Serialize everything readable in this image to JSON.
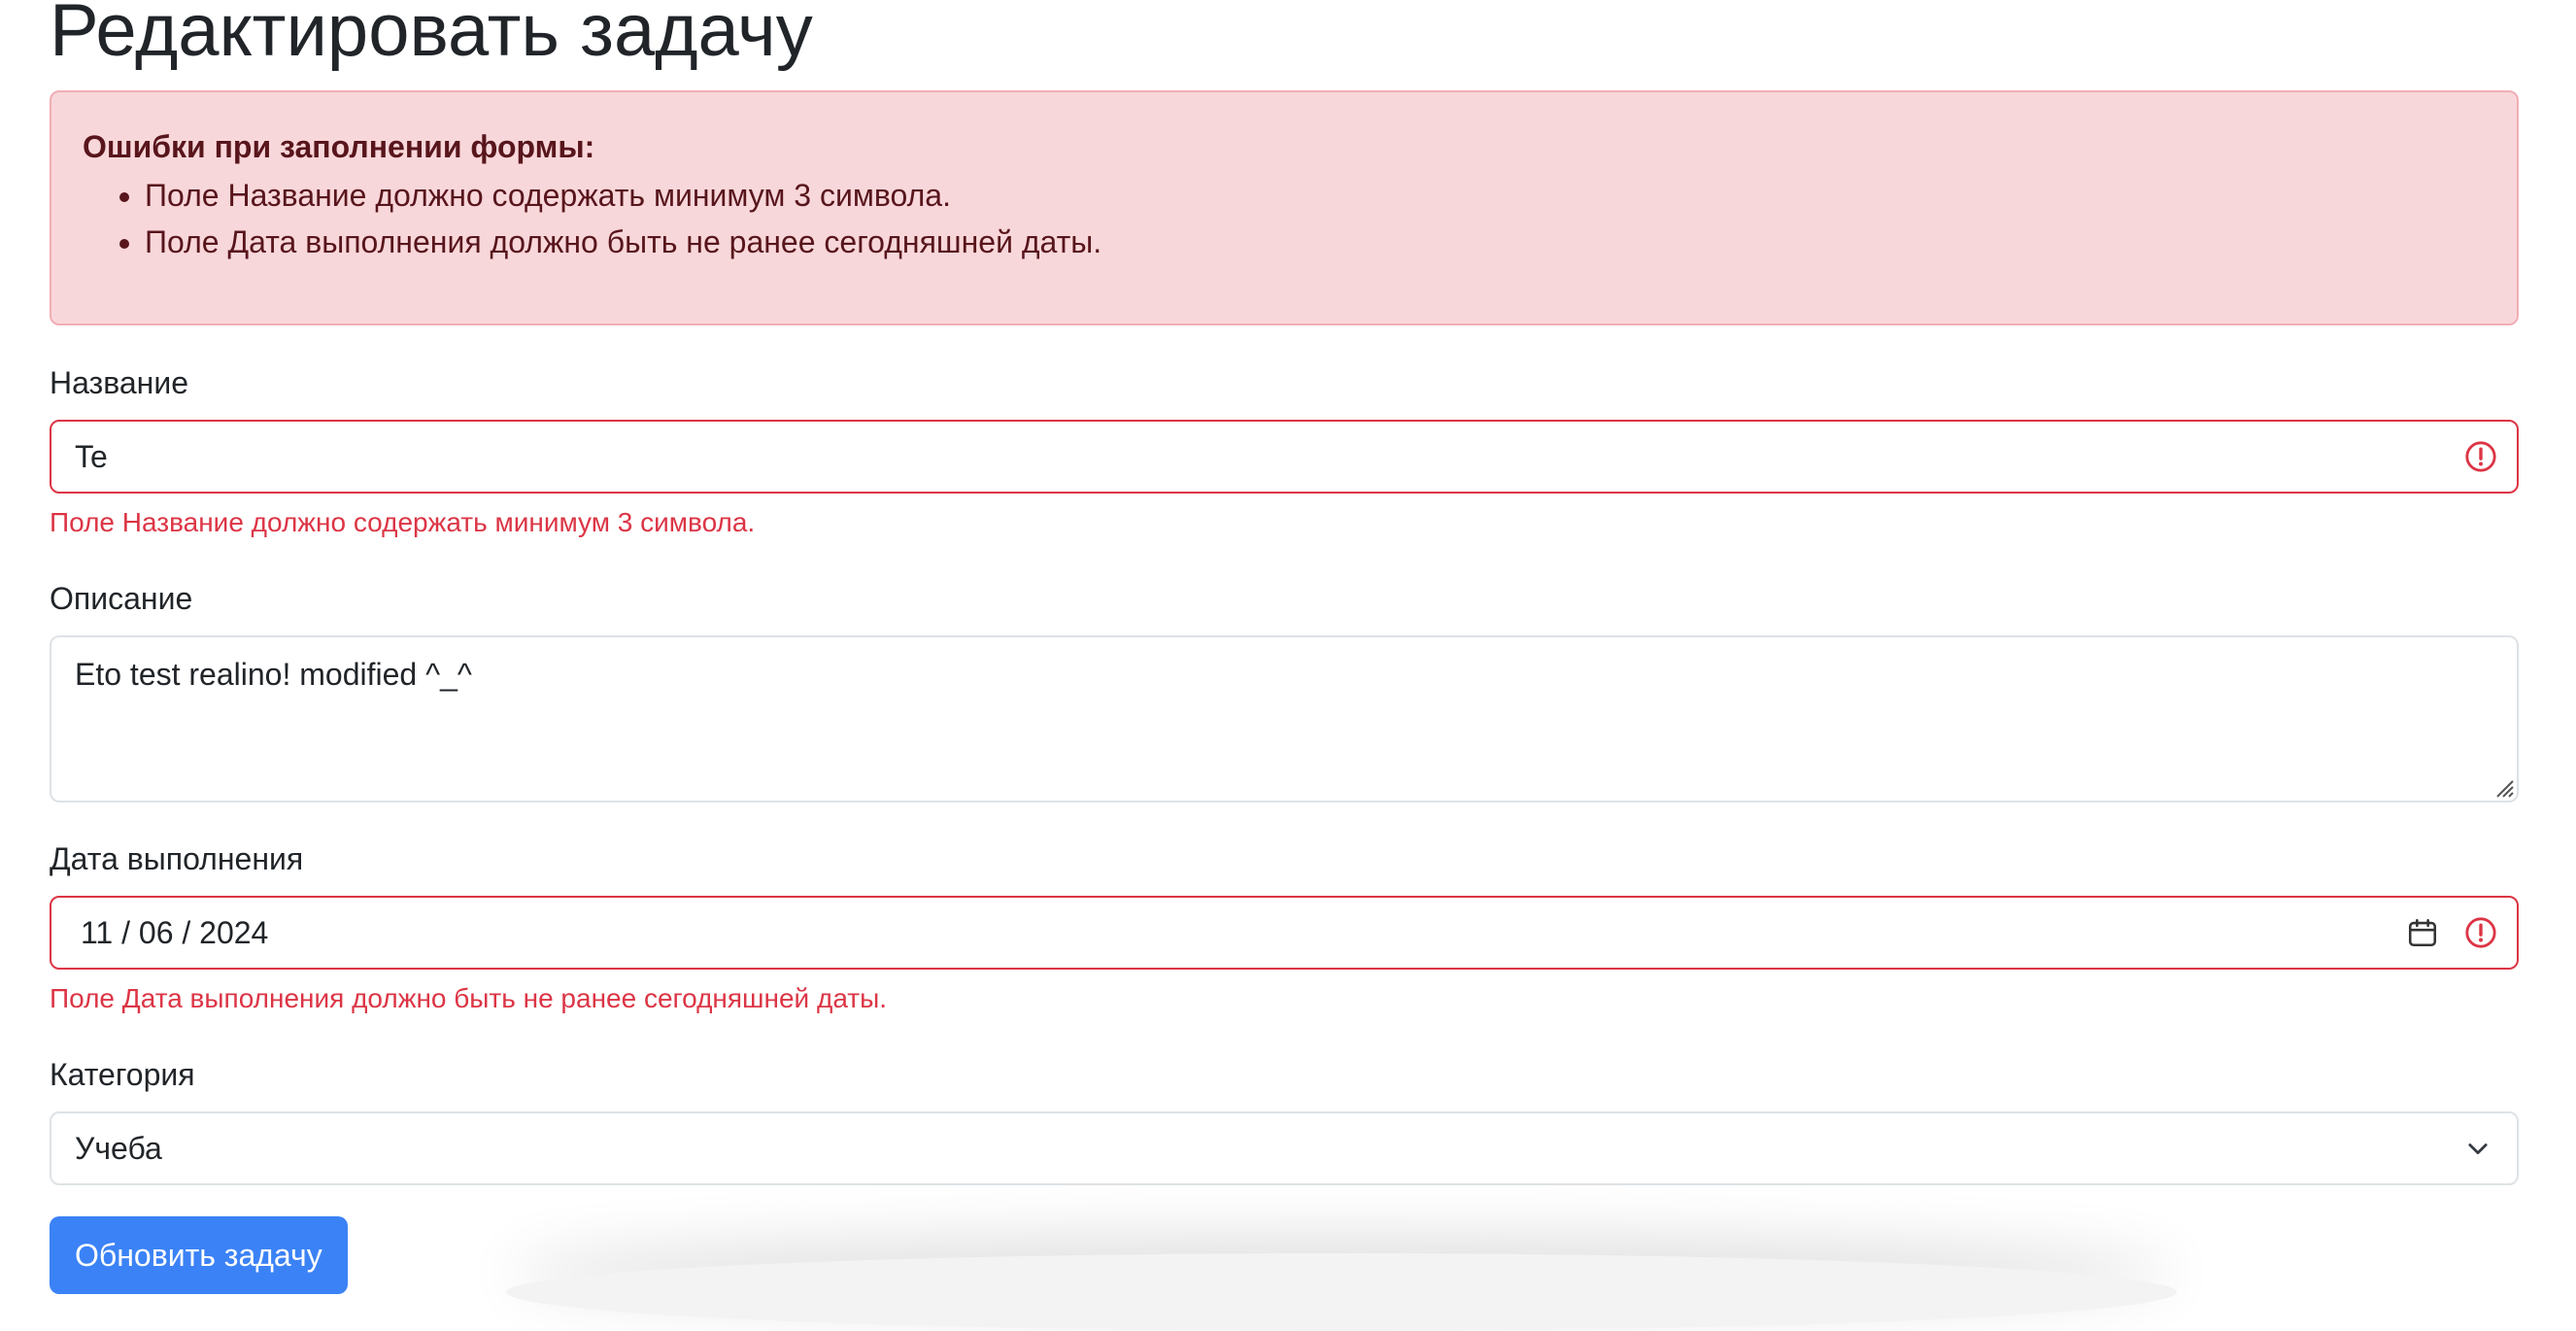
{
  "page": {
    "title": "Редактировать задачу"
  },
  "alert": {
    "heading": "Ошибки при заполнении формы:",
    "errors": [
      "Поле Название должно содержать минимум 3 символа.",
      "Поле Дата выполнения должно быть не ранее сегодняшней даты."
    ]
  },
  "form": {
    "title_field": {
      "label": "Название",
      "value": "Te",
      "error": "Поле Название должно содержать минимум 3 символа."
    },
    "description_field": {
      "label": "Описание",
      "value": "Eto test realino! modified ^_^"
    },
    "due_date_field": {
      "label": "Дата выполнения",
      "value": "11 / 06 / 2024",
      "error": "Поле Дата выполнения должно быть не ранее сегодняшней даты."
    },
    "category_field": {
      "label": "Категория",
      "value": "Учеба"
    },
    "submit_label": "Обновить задачу"
  },
  "colors": {
    "danger": "#dc3545",
    "alert_bg": "#f8d7da",
    "alert_border": "#f1aeb5",
    "alert_text": "#58151c",
    "primary_button": "#3b82f6"
  },
  "icons": {
    "invalid": "exclamation-circle-icon",
    "calendar": "calendar-icon",
    "select": "chevron-down-icon",
    "resize": "resize-handle-icon"
  }
}
